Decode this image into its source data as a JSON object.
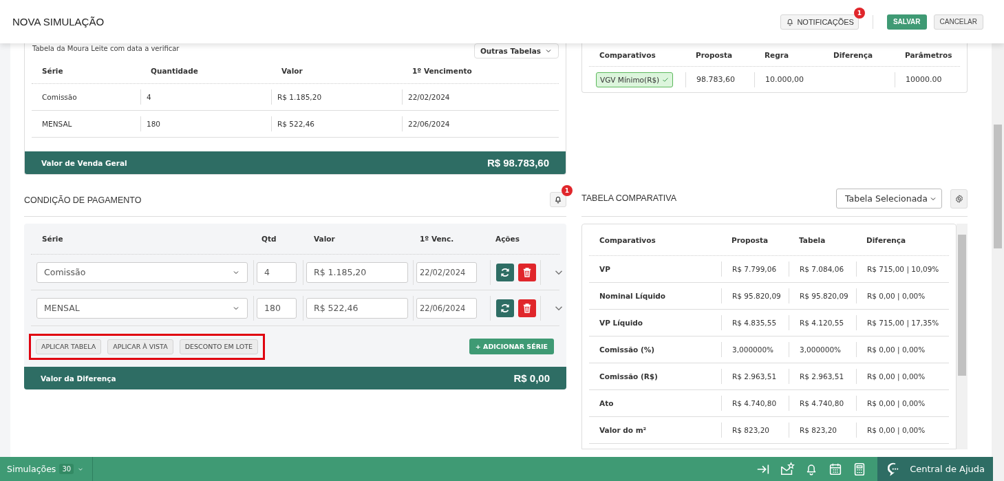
{
  "header": {
    "title": "NOVA SIMULAÇÃO",
    "notifications": {
      "label": "NOTIFICAÇÕES",
      "badge": "1"
    },
    "buttons": [
      {
        "label": "SALVAR",
        "kind": "primary"
      },
      {
        "label": "CANCELAR",
        "kind": "secondary"
      }
    ]
  },
  "sales_table": {
    "caption": "Tabela da Moura Leite com data a verificar",
    "other_tables": "Outras Tabelas",
    "columns": [
      "Série",
      "Quantidade",
      "Valor",
      "1º Vencimento"
    ],
    "rows": [
      [
        "Comissão",
        "4",
        "R$ 1.185,20",
        "22/02/2024"
      ],
      [
        "MENSAL",
        "180",
        "R$ 522,46",
        "22/06/2024"
      ]
    ],
    "total": {
      "label": "Valor de Venda Geral",
      "value": "R$ 98.783,60"
    }
  },
  "rules_table": {
    "columns": [
      "Comparativos",
      "Proposta",
      "Regra",
      "Diferença",
      "Parâmetros"
    ],
    "rows": [
      {
        "tag": "VGV Mínimo(R$)",
        "passed": true,
        "proposta": "98.783,60",
        "regra": "10.000,00",
        "parametros": "10000.00"
      }
    ]
  },
  "payment": {
    "title": "CONDIÇÃO DE PAGAMENTO",
    "badge": "1",
    "columns": [
      "Série",
      "Qtd",
      "Valor",
      "1º Venc.",
      "Ações"
    ],
    "rows": [
      {
        "serie": "Comissão",
        "qtd": "4",
        "valor": "R$ 1.185,20",
        "vencimento": "22/02/2024",
        "expanded": false
      },
      {
        "serie": "MENSAL",
        "qtd": "180",
        "valor": "R$ 522,46",
        "vencimento": "22/06/2024",
        "expanded": false
      }
    ],
    "batch_actions": {
      "highlighted": true,
      "buttons": [
        "APLICAR TABELA",
        "APLICAR À VISTA",
        "DESCONTO EM LOTE"
      ]
    },
    "add_button": "+ ADICIONAR SÉRIE",
    "total": {
      "label": "Valor da Diferença",
      "value": "R$ 0,00"
    }
  },
  "comparison": {
    "title": "TABELA COMPARATIVA",
    "select": "Tabela Selecionada",
    "columns": [
      "Comparativos",
      "Proposta",
      "Tabela",
      "Diferença"
    ],
    "rows": [
      [
        "VP",
        "R$ 7.799,06",
        "R$ 7.084,06",
        "R$ 715,00 | 10,09%"
      ],
      [
        "Nominal Líquido",
        "R$ 95.820,09",
        "R$ 95.820,09",
        "R$ 0,00 | 0,00%"
      ],
      [
        "VP Líquido",
        "R$ 4.835,55",
        "R$ 4.120,55",
        "R$ 715,00 | 17,35%"
      ],
      [
        "Comissão (%)",
        "3,000000%",
        "3,000000%",
        "R$ 0,00 | 0,00%"
      ],
      [
        "Comissão (R$)",
        "R$ 2.963,51",
        "R$ 2.963,51",
        "R$ 0,00 | 0,00%"
      ],
      [
        "Ato",
        "R$ 4.740,80",
        "R$ 4.740,80",
        "R$ 0,00 | 0,00%"
      ],
      [
        "Valor do m²",
        "R$ 823,20",
        "R$ 823,20",
        "R$ 0,00 | 0,00%"
      ]
    ]
  },
  "bottom_bar": {
    "simulations": {
      "label": "Simulações",
      "count": "30"
    },
    "help": "Central de Ajuda"
  }
}
